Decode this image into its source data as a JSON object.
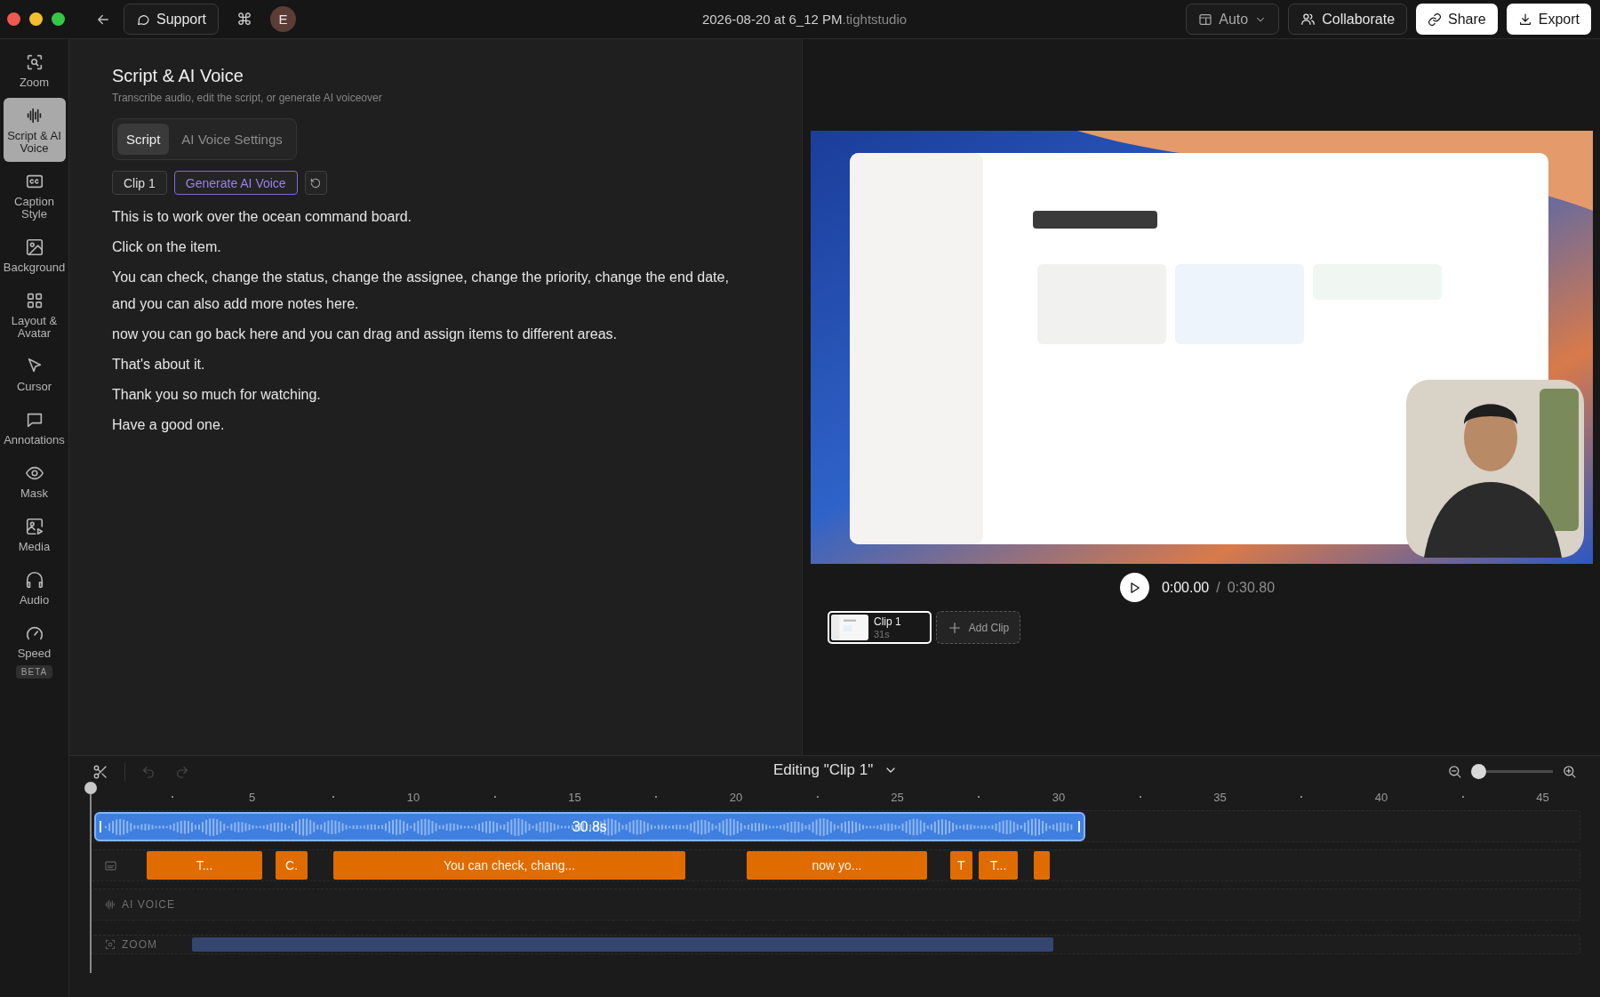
{
  "window": {
    "title": "2026-08-20 at 6_12 PM",
    "title_suffix": ".tightstudio"
  },
  "toolbar": {
    "support": "Support",
    "shortcut": "⌘",
    "avatar": "E",
    "layout_mode": "Auto",
    "collaborate": "Collaborate",
    "share": "Share",
    "export": "Export"
  },
  "sidebar": {
    "items": [
      {
        "label": "Zoom",
        "selected": false
      },
      {
        "label": "Script & AI Voice",
        "selected": true
      },
      {
        "label": "Caption Style",
        "selected": false
      },
      {
        "label": "Background",
        "selected": false
      },
      {
        "label": "Layout & Avatar",
        "selected": false
      },
      {
        "label": "Cursor",
        "selected": false
      },
      {
        "label": "Annotations",
        "selected": false
      },
      {
        "label": "Mask",
        "selected": false
      },
      {
        "label": "Media",
        "selected": false
      },
      {
        "label": "Audio",
        "selected": false
      },
      {
        "label": "Speed",
        "selected": false,
        "badge": "BETA"
      }
    ]
  },
  "panel": {
    "title": "Script & AI Voice",
    "subtitle": "Transcribe audio, edit the script, or generate AI voiceover",
    "tabs": [
      {
        "label": "Script",
        "selected": true
      },
      {
        "label": "AI Voice Settings",
        "selected": false
      }
    ],
    "clip_label": "Clip 1",
    "generate_button": "Generate AI Voice",
    "script": [
      "This is to work over the ocean command board.",
      "Click on the item.",
      "You can check, change the status, change the assignee, change the priority, change the end date, and you can also add more notes here.",
      "now you can go back here and you can drag and assign items to different areas.",
      "That's about it.",
      "Thank you so much for watching.",
      "Have a good one."
    ]
  },
  "preview": {
    "current_time": "0:00.00",
    "separator": "/",
    "duration": "0:30.80",
    "clips": [
      {
        "name": "Clip 1",
        "length": "31s",
        "selected": true
      }
    ],
    "add_clip": "Add Clip"
  },
  "timeline": {
    "title": "Editing \"Clip 1\"",
    "undo_disabled": true,
    "redo_disabled": true,
    "zoom": {
      "level": 0
    },
    "ruler": [
      "5",
      "10",
      "15",
      "20",
      "25",
      "30",
      "35",
      "40",
      "45"
    ],
    "audio_clip": {
      "label": "30.8s"
    },
    "captions": [
      {
        "kind": "text",
        "text": "T..."
      },
      {
        "kind": "text",
        "text": "C."
      },
      {
        "kind": "text",
        "text": "You can check, chang..."
      },
      {
        "kind": "text",
        "text": "now yo..."
      },
      {
        "kind": "text",
        "text": "T"
      },
      {
        "kind": "text",
        "text": "T..."
      },
      {
        "kind": "empty"
      }
    ],
    "ai_voice_label": "AI VOICE",
    "zoom_label": "ZOOM"
  }
}
